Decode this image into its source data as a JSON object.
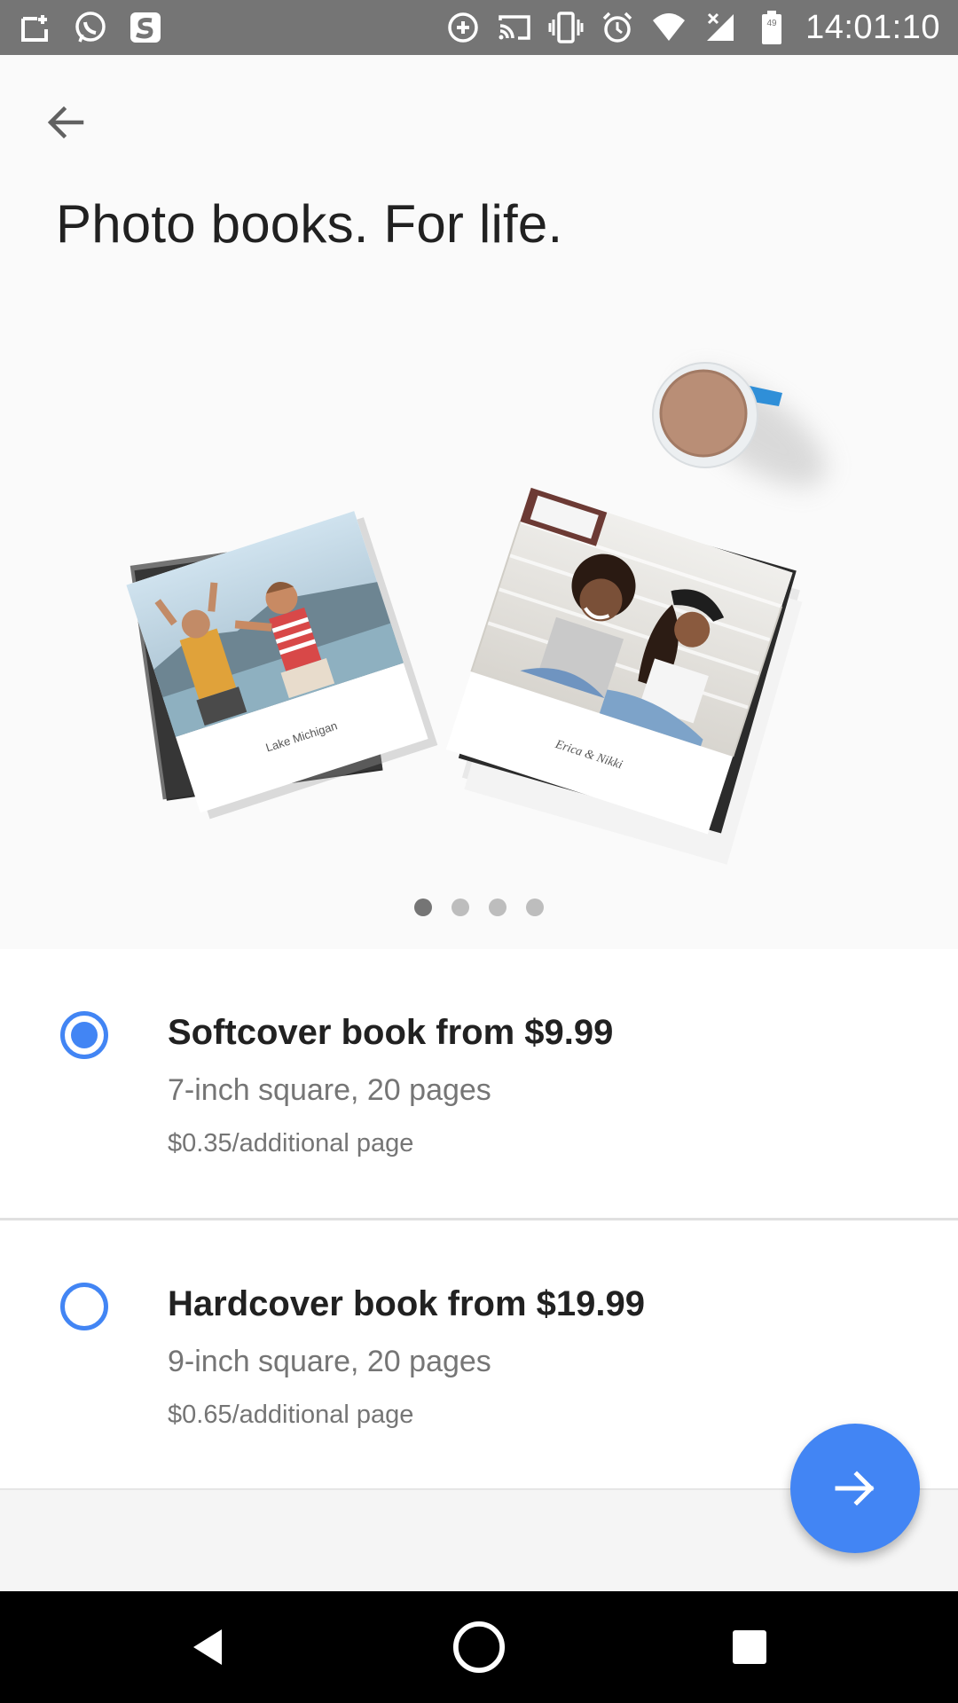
{
  "status_bar": {
    "time": "14:01:10",
    "battery_level": "49",
    "left_icons": [
      "screenshot-icon",
      "whatsapp-icon",
      "shazam-icon"
    ],
    "right_icons": [
      "data-saver-icon",
      "cast-icon",
      "vibrate-icon",
      "alarm-icon",
      "wifi-icon",
      "signal-icon",
      "battery-icon"
    ]
  },
  "header": {
    "title": "Photo books. For life."
  },
  "hero": {
    "book1_caption": "Lake Michigan",
    "book2_caption": "Erica & Nikki"
  },
  "carousel": {
    "page_count": 4,
    "active_index": 0
  },
  "options": [
    {
      "title": "Softcover book from $9.99",
      "subtitle": "7-inch square, 20 pages",
      "extra": "$0.35/additional page",
      "selected": true
    },
    {
      "title": "Hardcover book from $19.99",
      "subtitle": "9-inch square, 20 pages",
      "extra": "$0.65/additional page",
      "selected": false
    }
  ],
  "colors": {
    "accent": "#4285f4",
    "status_bar": "#757575",
    "nav_bar": "#000000"
  }
}
